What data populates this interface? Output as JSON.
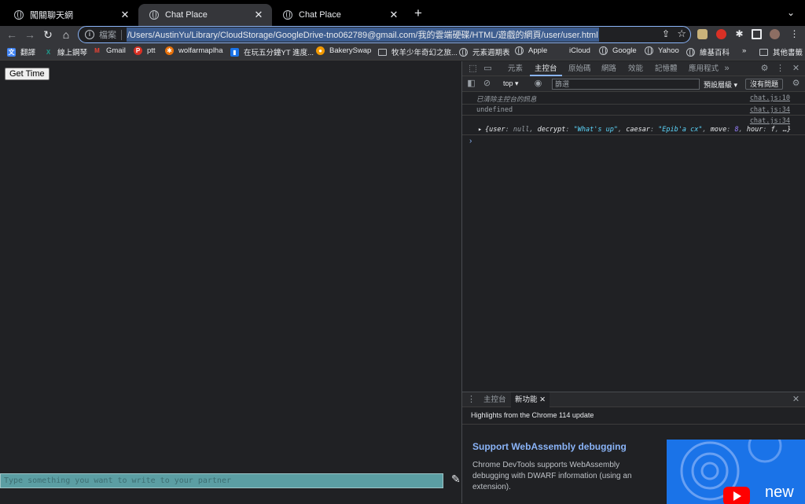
{
  "tabs": [
    {
      "title": "闖關聊天網",
      "active": false
    },
    {
      "title": "Chat Place",
      "active": true
    },
    {
      "title": "Chat Place",
      "active": false
    }
  ],
  "omnibox": {
    "scheme_label": "檔案",
    "url": "/Users/AustinYu/Library/CloudStorage/GoogleDrive-tno062789@gmail.com/我的雲端硬碟/HTML/遊戲的網頁/user/user.html"
  },
  "bookmarks": [
    {
      "label": "翻譯",
      "icon": "translate-icon",
      "color": "#4285f4"
    },
    {
      "label": "線上鋼琴",
      "icon": "piano-icon",
      "color": "#1d9e8f"
    },
    {
      "label": "Gmail",
      "icon": "gmail-icon",
      "color": "#ea4335"
    },
    {
      "label": "ptt",
      "icon": "ptt-icon",
      "color": "#d93025"
    },
    {
      "label": "wolfarmaplha",
      "icon": "wolfram-icon",
      "color": "#e8710a"
    },
    {
      "label": "在玩五分鐘YT 進度...",
      "icon": "trello-icon",
      "color": "#1a73e8"
    },
    {
      "label": "BakerySwap",
      "icon": "bakery-icon",
      "color": "#f29900"
    },
    {
      "label": "牧羊少年奇幻之旅...",
      "icon": "folder-icon",
      "color": ""
    },
    {
      "label": "元素週期表",
      "icon": "globe-icon",
      "color": ""
    },
    {
      "label": "Apple",
      "icon": "globe-icon",
      "color": ""
    },
    {
      "label": "iCloud",
      "icon": "apple-icon",
      "color": ""
    },
    {
      "label": "Google",
      "icon": "globe-icon",
      "color": ""
    },
    {
      "label": "Yahoo",
      "icon": "globe-icon",
      "color": ""
    },
    {
      "label": "維基百科",
      "icon": "globe-icon",
      "color": ""
    }
  ],
  "bookmarks_more": "»",
  "other_bookmarks": "其他書籤",
  "page": {
    "button_label": "Get Time",
    "input_placeholder": "Type something you want to write to your partner"
  },
  "devtools": {
    "tabs": [
      "元素",
      "主控台",
      "原始碼",
      "網路",
      "效能",
      "記憶體",
      "應用程式"
    ],
    "active_tab": "主控台",
    "context": "top",
    "filter_placeholder": "篩選",
    "levels": "預設層級",
    "issues": "沒有問題",
    "logs": [
      {
        "message": "已清除主控台的訊息",
        "source": "chat.js:10"
      },
      {
        "message": "undefined",
        "source": "chat.js:34"
      },
      {
        "message": "",
        "source": "chat.js:34"
      }
    ],
    "object_preview": {
      "user": "null",
      "decrypt": "\"What's up\"",
      "caesar": "\"Epib'a cx\"",
      "move": "8",
      "hour": "f",
      "rest": "…"
    },
    "drawer": {
      "tabs": [
        "主控台",
        "新功能"
      ],
      "active_tab": "新功能",
      "highlights": "Highlights from the Chrome 114 update",
      "article_title": "Support WebAssembly debugging",
      "article_desc": "Chrome DevTools supports WebAssembly debugging with DWARF information (using an extension).",
      "promo_text": "new"
    }
  },
  "colors": {
    "accent": "#8ab4f8",
    "input_bg": "#5b9ea3",
    "page_bg": "#202124"
  }
}
